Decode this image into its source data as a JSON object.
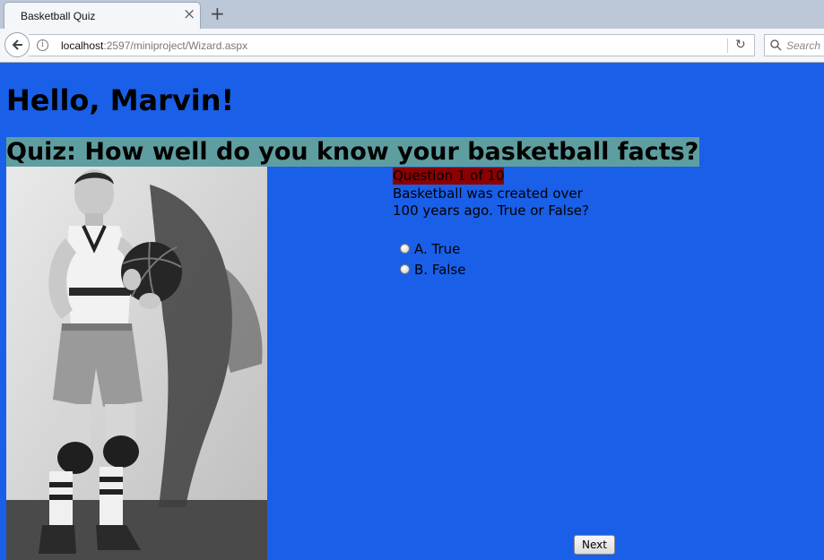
{
  "browser": {
    "tab_title": "Basketball Quiz",
    "url_host": "localhost",
    "url_path": ":2597/miniproject/Wizard.aspx",
    "search_placeholder": "Search"
  },
  "page": {
    "greeting": "Hello, Marvin!",
    "quiz_title": "Quiz: How well do you know your basketball facts?",
    "question_counter": "Question 1 of 10",
    "question_text": "Basketball was created over 100 years ago. True or False?",
    "options": [
      {
        "label": "A. True"
      },
      {
        "label": "B. False"
      }
    ],
    "next_label": "Next"
  },
  "colors": {
    "page_background": "#1a5fe8",
    "title_highlight": "#5f9ea0",
    "counter_highlight": "#8b0000"
  }
}
